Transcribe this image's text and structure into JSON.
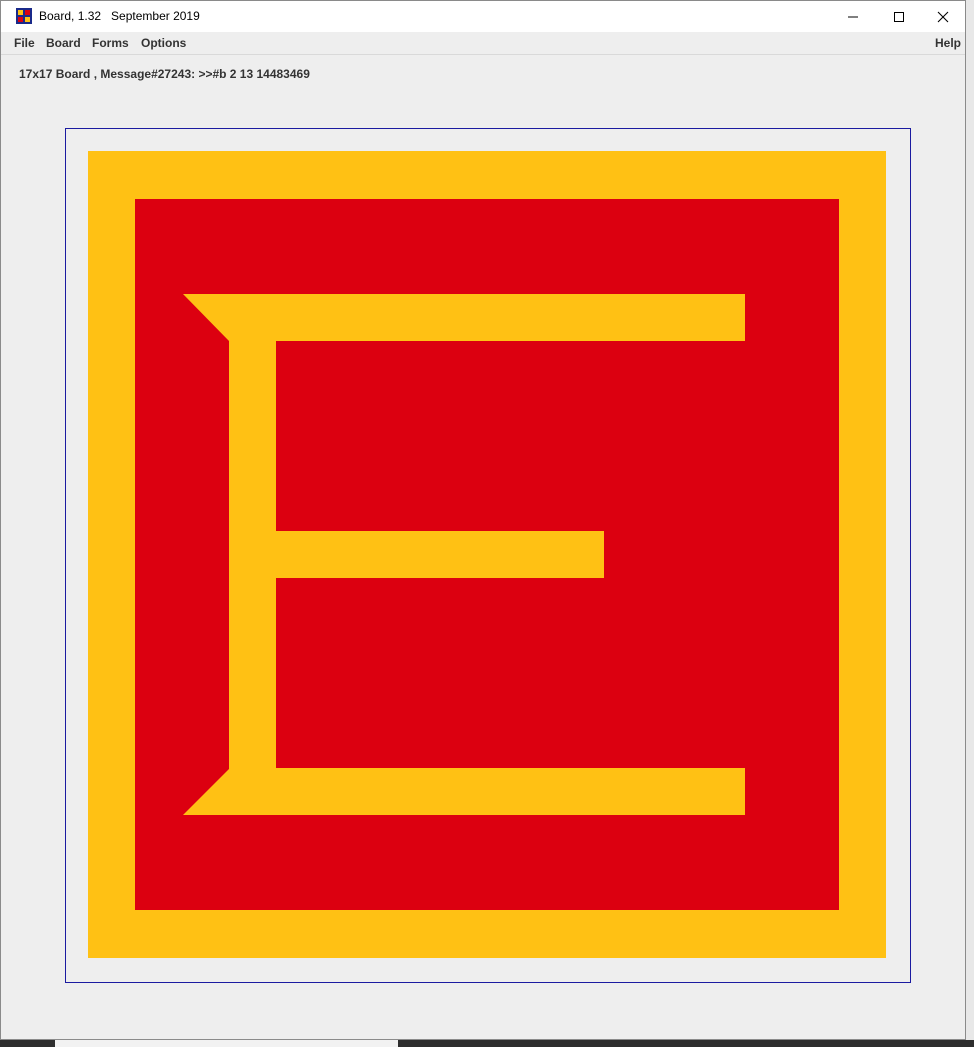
{
  "window": {
    "title": "Board, 1.32   September 2019",
    "icon": "board-app-icon",
    "controls": [
      "minimize-icon",
      "maximize-icon",
      "close-icon"
    ]
  },
  "menu": {
    "file": "File",
    "board": "Board",
    "forms": "Forms",
    "options": "Options",
    "help": "Help"
  },
  "status": {
    "message": "17x17 Board , Message#27243: >>#b 2 13 14483469"
  },
  "board": {
    "size": "17x17",
    "glyph": "E",
    "colors": {
      "background": "#FFC114",
      "foreground": "#DC0010",
      "frame": "#1A1AA0",
      "window": "#EEEEEE"
    }
  }
}
